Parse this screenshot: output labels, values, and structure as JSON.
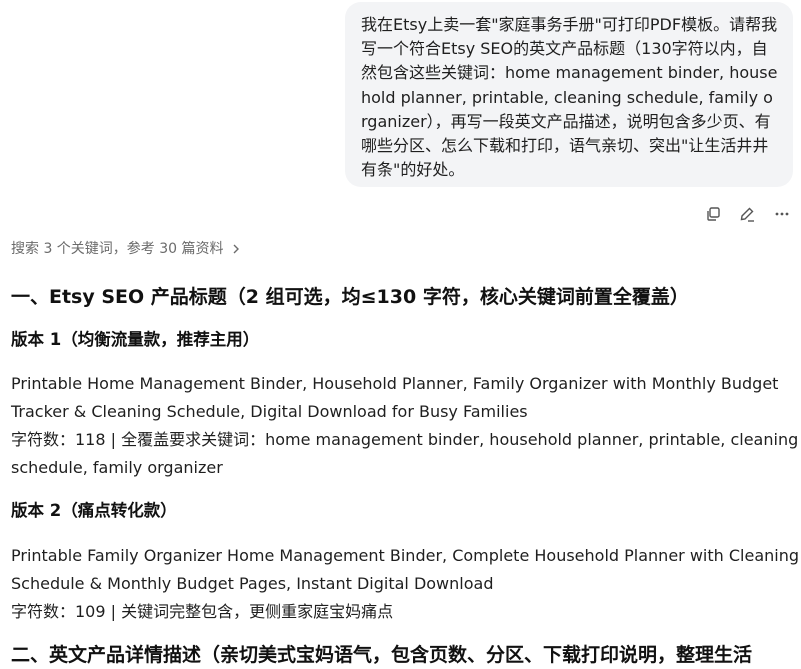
{
  "user_message": {
    "text": "我在Etsy上卖一套\"家庭事务手册\"可打印PDF模板。请帮我写一个符合Etsy SEO的英文产品标题（130字符以内，自然包含这些关键词：home management binder, household planner, printable, cleaning schedule, family organizer），再写一段英文产品描述，说明包含多少页、有哪些分区、怎么下载和打印，语气亲切、突出\"让生活井井有条\"的好处。"
  },
  "message_actions": {
    "icons": [
      "copy-icon",
      "edit-icon",
      "more-icon"
    ]
  },
  "search_info": {
    "label": "搜索 3 个关键词，参考 30 篇资料"
  },
  "answer": {
    "section1_title": "一、Etsy SEO 产品标题（2 组可选，均≤130 字符，核心关键词前置全覆盖）",
    "version1_title": "版本 1（均衡流量款，推荐主用）",
    "version1_text": "Printable Home Management Binder, Household Planner, Family Organizer with Monthly Budget Tracker & Cleaning Schedule, Digital Download for Busy Families",
    "version1_meta": "字符数：118 | 全覆盖要求关键词：home management binder, household planner, printable, cleaning schedule, family organizer",
    "version2_title": "版本 2（痛点转化款）",
    "version2_text": "Printable Family Organizer Home Management Binder, Complete Household Planner with Cleaning Schedule & Monthly Budget Pages, Instant Digital Download",
    "version2_meta": "字符数：109 | 关键词完整包含，更侧重家庭宝妈痛点",
    "section2_title": "二、英文产品详情描述（亲切美式宝妈语气，包含页数、分区、下载打印说明，整理生活"
  },
  "colors": {
    "bubble_bg": "#f3f4f6",
    "muted_text": "#6b6b6b",
    "icon_color": "#555555"
  }
}
